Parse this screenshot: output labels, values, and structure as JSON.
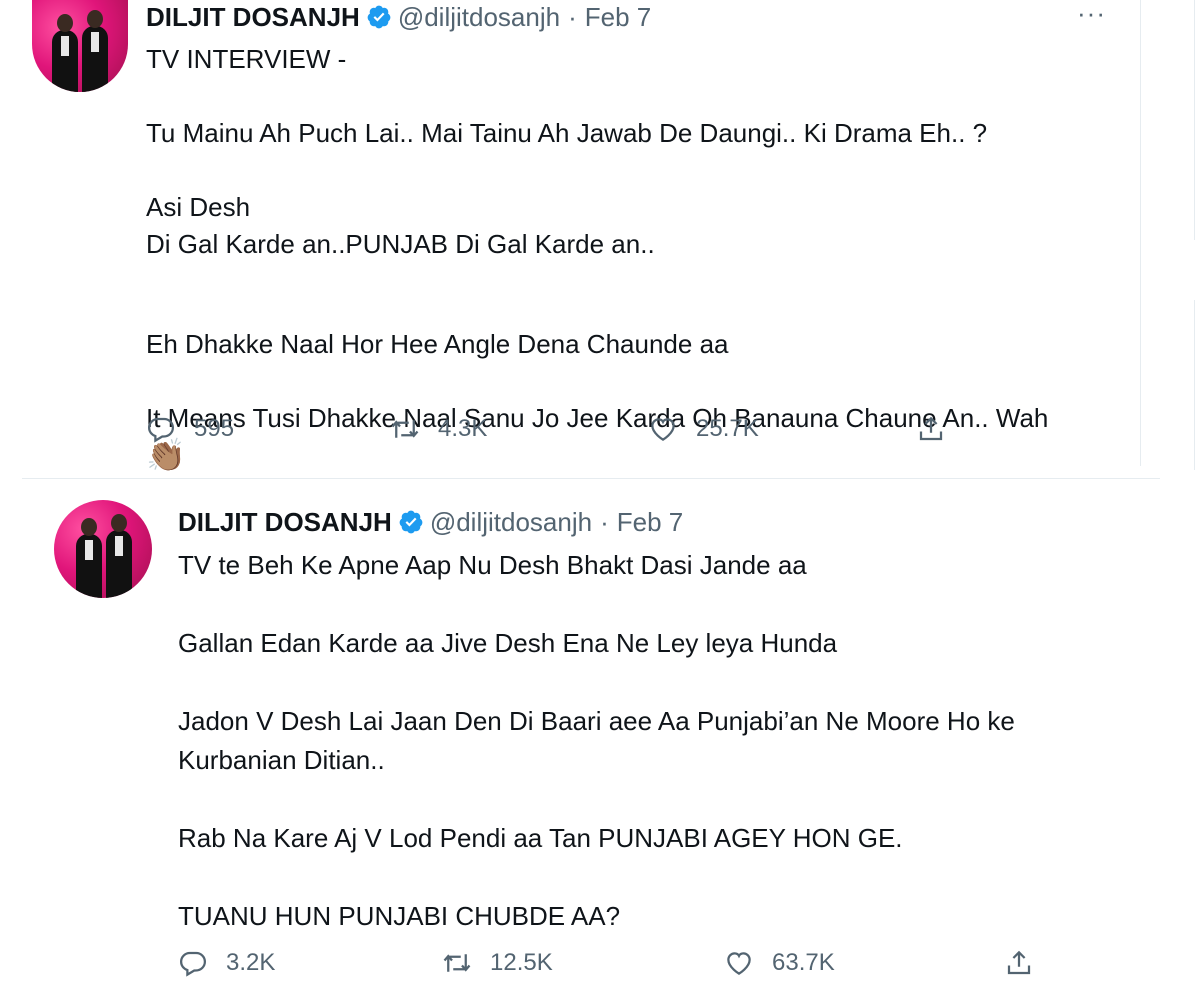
{
  "tweets": [
    {
      "name": "DILJIT DOSANJH",
      "handle": "@diljitdosanjh",
      "separator": "·",
      "date": "Feb 7",
      "more": "···",
      "lines": [
        "TV INTERVIEW -",
        "",
        "Tu Mainu Ah Puch Lai.. Mai Tainu Ah Jawab De Daungi.. Ki Drama Eh.. ?",
        "",
        "Asi Desh",
        "Di Gal Karde an..PUNJAB Di Gal Karde an..",
        "",
        "Eh Dhakke Naal Hor Hee Angle Dena Chaunde aa",
        "",
        "It Means Tusi Dhakke Naal Sanu Jo Jee Karda Oh Banauna Chaune An.. Wah"
      ],
      "clap": "👏🏽",
      "stats": {
        "replies": "595",
        "retweets": "4.3K",
        "likes": "25.7K"
      }
    },
    {
      "name": "DILJIT DOSANJH",
      "handle": "@diljitdosanjh",
      "separator": "·",
      "date": "Feb 7",
      "lines": [
        "TV te Beh Ke Apne Aap Nu Desh Bhakt Dasi Jande aa",
        "Gallan Edan Karde aa Jive Desh Ena Ne Ley leya Hunda",
        "Jadon V Desh Lai Jaan Den Di Baari aee Aa Punjabi’an Ne Moore Ho ke",
        "Kurbanian Ditian..",
        "Rab Na Kare Aj V Lod Pendi aa Tan PUNJABI AGEY HON GE.",
        "TUANU HUN PUNJABI CHUBDE AA?"
      ],
      "stats": {
        "replies": "3.2K",
        "retweets": "12.5K",
        "likes": "63.7K"
      }
    }
  ],
  "icons": {
    "verified": "verified-badge-icon",
    "reply": "reply-icon",
    "retweet": "retweet-icon",
    "like": "heart-icon",
    "share": "share-icon",
    "flag": "india-flag-icon"
  },
  "colors": {
    "verified": "#1d9bf0",
    "text": "#0f1419",
    "muted": "#536471",
    "avatar_bg": "#e0157a"
  }
}
